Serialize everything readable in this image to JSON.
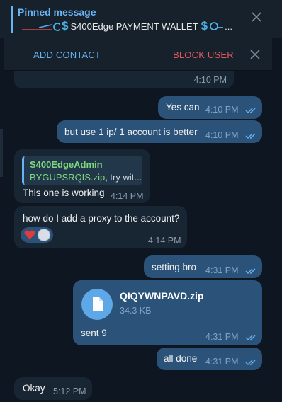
{
  "pinned": {
    "title": "Pinned message",
    "text": "S400Edge PAYMENT WALLET",
    "ellipsis": "..."
  },
  "actions": {
    "add_contact": "ADD CONTACT",
    "block_user": "BLOCK USER"
  },
  "messages": [
    {
      "text": "",
      "time": "4:10 PM",
      "dir": "in"
    },
    {
      "text": "Yes can",
      "time": "4:10 PM",
      "dir": "out"
    },
    {
      "text": "but use 1 ip/ 1 account is better",
      "time": "4:10 PM",
      "dir": "out"
    },
    {
      "reply_name": "S400EdgeAdmin",
      "reply_file": "BYGUPSRQIS.zip",
      "reply_rest": ", try wit...",
      "text": "This one is working",
      "time": "4:14 PM",
      "dir": "in"
    },
    {
      "text": "how do I add a proxy to the account?",
      "time": "4:14 PM",
      "dir": "in",
      "reactions": [
        "heart",
        "avatar"
      ]
    },
    {
      "text": "setting bro",
      "time": "4:31 PM",
      "dir": "out"
    },
    {
      "file_name": "QIQYWNPAVD.zip",
      "file_size": "34.3 KB",
      "text": "sent 9",
      "time": "4:31 PM",
      "dir": "out"
    },
    {
      "text": "all done",
      "time": "4:31 PM",
      "dir": "out"
    },
    {
      "text": "Okay",
      "time": "5:12 PM",
      "dir": "in"
    }
  ],
  "colors": {
    "background": "#0e1621",
    "incoming": "#182533",
    "outgoing": "#2b5278",
    "accent": "#6ab3f3",
    "danger": "#e0575c"
  },
  "icons": [
    "close-icon",
    "dollar-icon",
    "double-check-icon",
    "file-icon",
    "heart-icon"
  ]
}
